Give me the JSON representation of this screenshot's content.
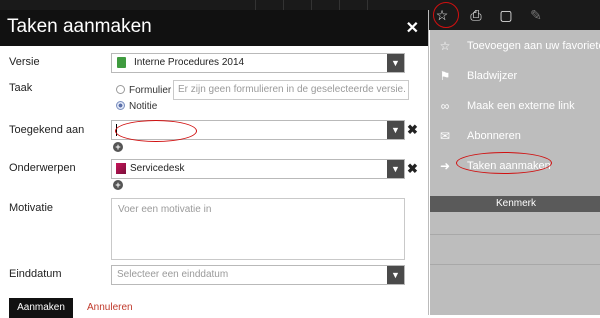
{
  "dialog": {
    "title": "Taken aanmaken",
    "close_icon": "close-icon",
    "fields": {
      "versie": {
        "label": "Versie",
        "value": "Interne Procedures 2014"
      },
      "taak": {
        "label": "Taak",
        "options": [
          "Formulier",
          "Notitie"
        ],
        "selected": "Notitie",
        "placeholder": "Er zijn geen formulieren in de geselecteerde versie."
      },
      "toegekend": {
        "label": "Toegekend aan",
        "value": ""
      },
      "onderwerpen": {
        "label": "Onderwerpen",
        "value": "Servicedesk"
      },
      "motivatie": {
        "label": "Motivatie",
        "placeholder": "Voer een motivatie in"
      },
      "einddatum": {
        "label": "Einddatum",
        "placeholder": "Selecteer een einddatum"
      }
    },
    "buttons": {
      "submit": "Aanmaken",
      "cancel": "Annuleren"
    }
  },
  "background": {
    "toolbar_icons": [
      "star-icon",
      "print-icon",
      "comment-icon",
      "edit-icon"
    ],
    "menu": [
      {
        "icon": "star-icon",
        "label": "Toevoegen aan uw favorieten"
      },
      {
        "icon": "bookmark-icon",
        "label": "Bladwijzer"
      },
      {
        "icon": "link-icon",
        "label": "Maak een externe link"
      },
      {
        "icon": "envelope-icon",
        "label": "Abonneren"
      },
      {
        "icon": "task-icon",
        "label": "Taken aanmaken"
      }
    ],
    "table_header": "Kenmerk"
  },
  "colors": {
    "header": "#111111",
    "cancel_link": "#c0392b",
    "annotation": "#d01010",
    "overlay": "#bdbdbd"
  }
}
